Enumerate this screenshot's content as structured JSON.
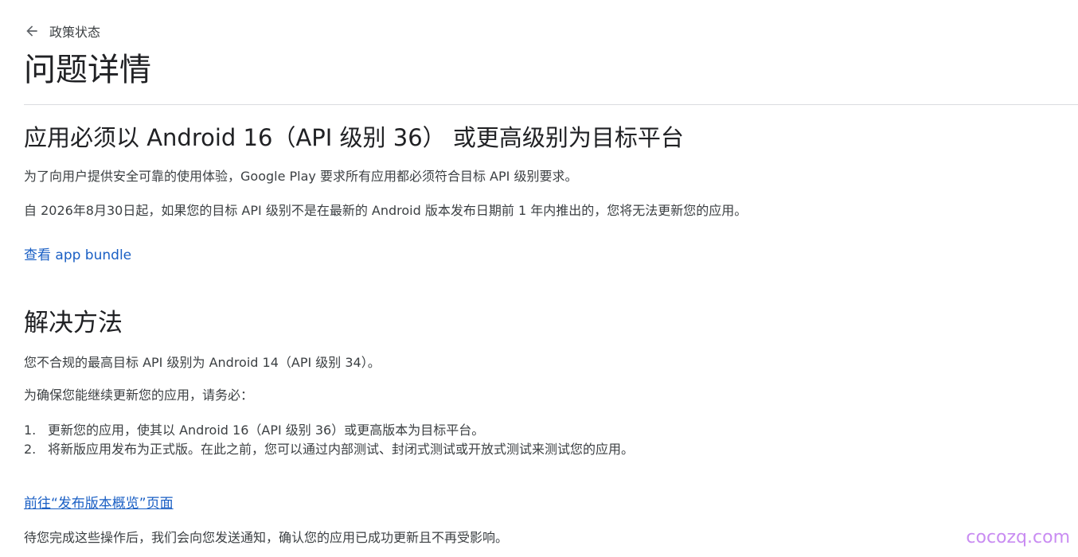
{
  "header": {
    "back_label": "政策状态",
    "title": "问题详情"
  },
  "issue": {
    "title": "应用必须以 Android 16（API 级别 36） 或更高级别为目标平台",
    "desc1": "为了向用户提供安全可靠的使用体验，Google Play 要求所有应用都必须符合目标 API 级别要求。",
    "desc2": "自 2026年8月30日起，如果您的目标 API 级别不是在最新的 Android 版本发布日期前 1 年内推出的，您将无法更新您的应用。",
    "view_bundle_link": "查看 app bundle"
  },
  "resolution": {
    "title": "解决方法",
    "current_level": "您不合规的最高目标 API 级别为 Android 14（API 级别 34）。",
    "intro": "为确保您能继续更新您的应用，请务必：",
    "steps": [
      {
        "num": "1.",
        "text": "更新您的应用，使其以 Android 16（API 级别 36）或更高版本为目标平台。"
      },
      {
        "num": "2.",
        "text": "将新版应用发布为正式版。在此之前，您可以通过内部测试、封闭式测试或开放式测试来测试您的应用。"
      }
    ],
    "release_overview_link": "前往“发布版本概览”页面",
    "footer_note": "待您完成这些操作后，我们会向您发送通知，确认您的应用已成功更新且不再受影响。"
  },
  "watermark": "cocozq.com",
  "colors": {
    "link": "#1a5fc4",
    "text": "#3c4043",
    "heading": "#202124",
    "divider": "#dadce0",
    "watermark": "#c98cf2"
  }
}
